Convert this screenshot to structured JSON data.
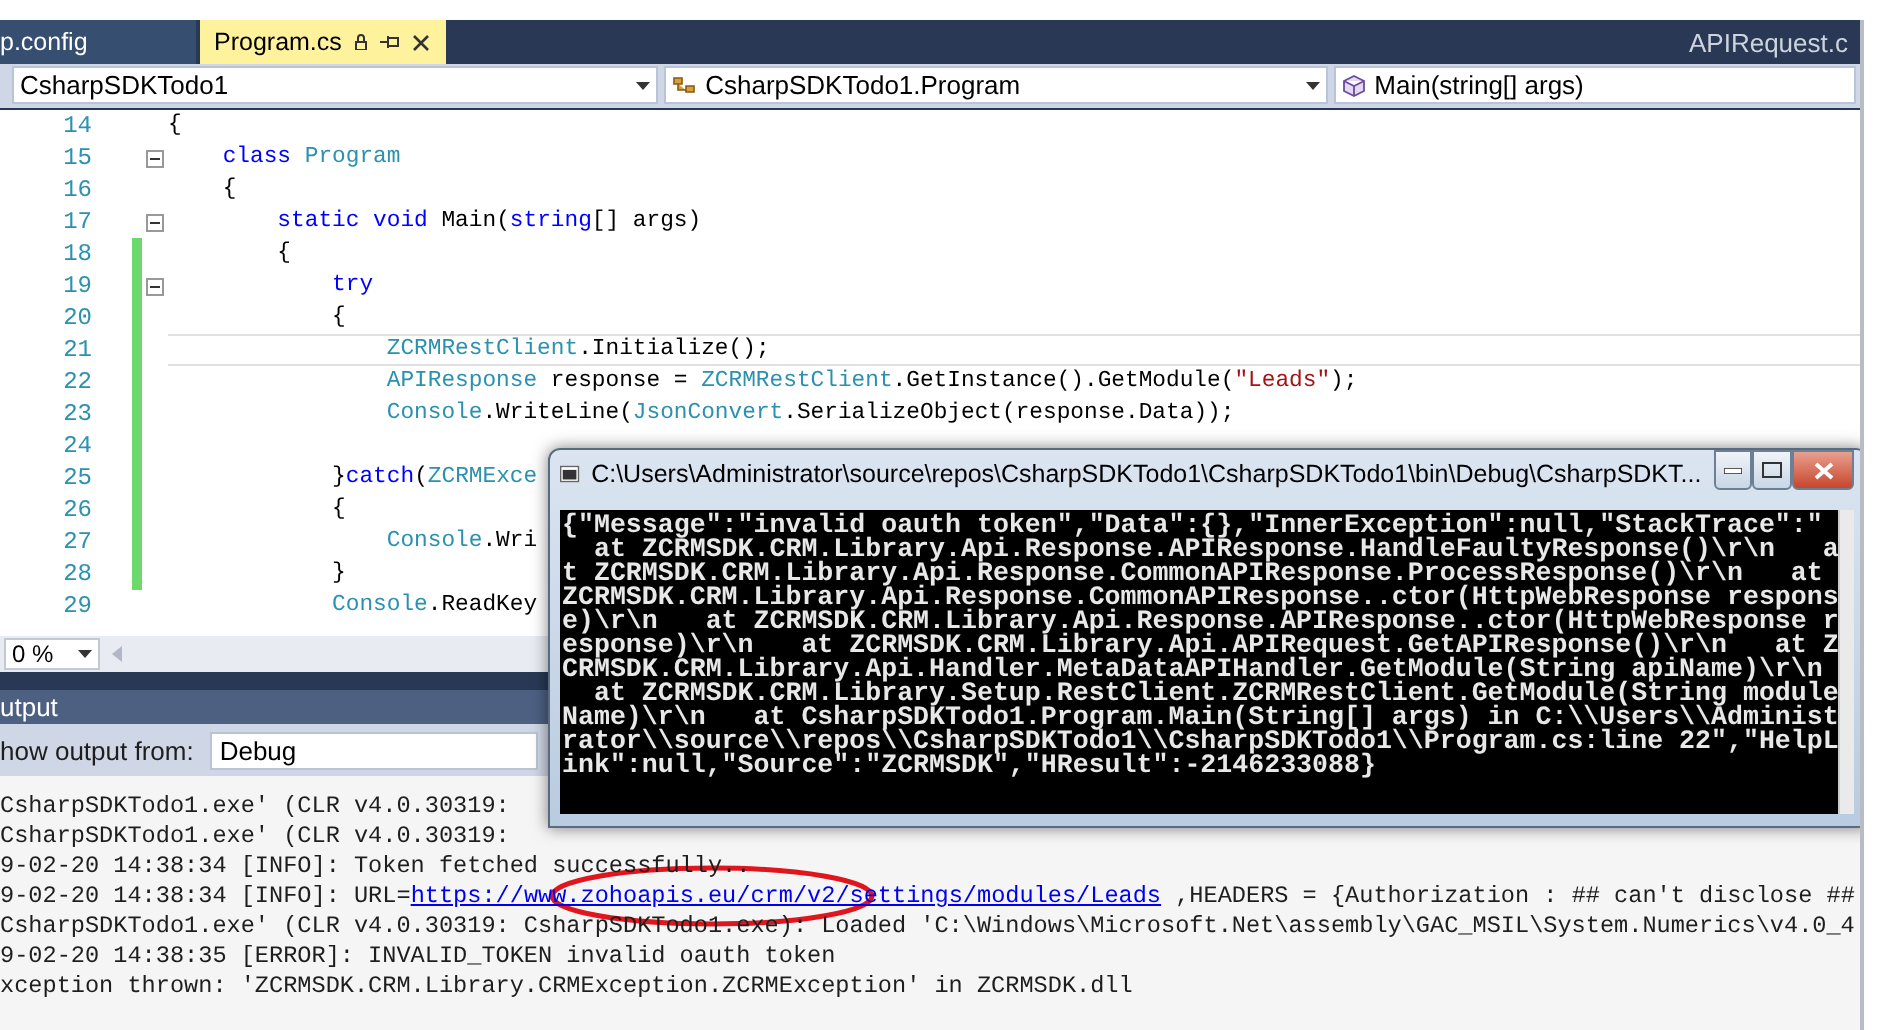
{
  "tabs": [
    {
      "label": "p.config",
      "selected": false
    },
    {
      "label": "Program.cs",
      "selected": true
    }
  ],
  "overflow_tab": "APIRequest.c",
  "navigation": {
    "project": "CsharpSDKTodo1",
    "type": "CsharpSDKTodo1.Program",
    "member": "Main(string[] args)"
  },
  "editor": {
    "zoom": "0 %",
    "lines": [
      {
        "number": "14",
        "changed": false,
        "fold": false,
        "current": false,
        "tokens": [
          {
            "kind": "plain",
            "text": "{"
          }
        ]
      },
      {
        "number": "15",
        "changed": false,
        "fold": true,
        "current": false,
        "tokens": [
          {
            "kind": "keyword",
            "text": "    class"
          },
          {
            "kind": "type",
            "text": " Program"
          }
        ]
      },
      {
        "number": "16",
        "changed": false,
        "fold": false,
        "current": false,
        "tokens": [
          {
            "kind": "plain",
            "text": "    {"
          }
        ]
      },
      {
        "number": "17",
        "changed": false,
        "fold": true,
        "current": false,
        "tokens": [
          {
            "kind": "keyword",
            "text": "        static"
          },
          {
            "kind": "keyword",
            "text": " void"
          },
          {
            "kind": "plain",
            "text": " Main("
          },
          {
            "kind": "keyword",
            "text": "string"
          },
          {
            "kind": "plain",
            "text": "[] args)"
          }
        ]
      },
      {
        "number": "18",
        "changed": true,
        "fold": false,
        "current": false,
        "tokens": [
          {
            "kind": "plain",
            "text": "        {"
          }
        ]
      },
      {
        "number": "19",
        "changed": true,
        "fold": true,
        "current": false,
        "tokens": [
          {
            "kind": "keyword",
            "text": "            try"
          }
        ]
      },
      {
        "number": "20",
        "changed": true,
        "fold": false,
        "current": false,
        "tokens": [
          {
            "kind": "plain",
            "text": "            {"
          }
        ]
      },
      {
        "number": "21",
        "changed": true,
        "fold": false,
        "current": true,
        "tokens": [
          {
            "kind": "type",
            "text": "                ZCRMRestClient"
          },
          {
            "kind": "plain",
            "text": ".Initialize();"
          }
        ]
      },
      {
        "number": "22",
        "changed": true,
        "fold": false,
        "current": false,
        "tokens": [
          {
            "kind": "type",
            "text": "                APIResponse"
          },
          {
            "kind": "plain",
            "text": " response = "
          },
          {
            "kind": "type",
            "text": "ZCRMRestClient"
          },
          {
            "kind": "plain",
            "text": ".GetInstance().GetModule("
          },
          {
            "kind": "string",
            "text": "\"Leads\""
          },
          {
            "kind": "plain",
            "text": ");"
          }
        ]
      },
      {
        "number": "23",
        "changed": true,
        "fold": false,
        "current": false,
        "tokens": [
          {
            "kind": "type",
            "text": "                Console"
          },
          {
            "kind": "plain",
            "text": ".WriteLine("
          },
          {
            "kind": "type",
            "text": "JsonConvert"
          },
          {
            "kind": "plain",
            "text": ".SerializeObject(response.Data));"
          }
        ]
      },
      {
        "number": "24",
        "changed": true,
        "fold": false,
        "current": false
      },
      {
        "number": "25",
        "changed": true,
        "fold": false,
        "current": false,
        "tokens": [
          {
            "kind": "plain",
            "text": "            }"
          },
          {
            "kind": "keyword",
            "text": "catch"
          },
          {
            "kind": "plain",
            "text": "("
          },
          {
            "kind": "type",
            "text": "ZCRMExce"
          }
        ]
      },
      {
        "number": "26",
        "changed": true,
        "fold": false,
        "current": false,
        "tokens": [
          {
            "kind": "plain",
            "text": "            {"
          }
        ]
      },
      {
        "number": "27",
        "changed": true,
        "fold": false,
        "current": false,
        "tokens": [
          {
            "kind": "type",
            "text": "                Console"
          },
          {
            "kind": "plain",
            "text": ".Wri"
          }
        ]
      },
      {
        "number": "28",
        "changed": true,
        "fold": false,
        "current": false,
        "tokens": [
          {
            "kind": "plain",
            "text": "            }"
          }
        ]
      },
      {
        "number": "29",
        "changed": false,
        "fold": false,
        "current": false,
        "tokens": [
          {
            "kind": "type",
            "text": "            Console"
          },
          {
            "kind": "plain",
            "text": ".ReadKey"
          }
        ]
      }
    ]
  },
  "output": {
    "title": "utput",
    "source_label": "how output from:",
    "source": "Debug",
    "lines": [
      {
        "text": "CsharpSDKTodo1.exe' (CLR v4.0.30319:"
      },
      {
        "text": "CsharpSDKTodo1.exe' (CLR v4.0.30319:"
      },
      {
        "text": "9-02-20 14:38:34 [INFO]: Token fetched successfully.."
      },
      {
        "text": "9-02-20 14:38:34 [INFO]: URL=",
        "link": "https://www.zohoapis.eu/crm/v2/settings/modules/Leads",
        "rest": " ,HEADERS = {Authorization : ## can't disclose ##"
      },
      {
        "text": "CsharpSDKTodo1.exe' (CLR v4.0.30319: CsharpSDKTodo1.exe): Loaded 'C:\\Windows\\Microsoft.Net\\assembly\\GAC_MSIL\\System.Numerics\\v4.0_4"
      },
      {
        "text": "9-02-20 14:38:35 [ERROR]: INVALID_TOKEN invalid oauth token"
      },
      {
        "text": "xception thrown: 'ZCRMSDK.CRM.Library.CRMException.ZCRMException' in ZCRMSDK.dll"
      }
    ]
  },
  "console": {
    "title": "C:\\Users\\Administrator\\source\\repos\\CsharpSDKTodo1\\CsharpSDKTodo1\\bin\\Debug\\CsharpSDKT...",
    "lines": [
      "{\"Message\":\"invalid oauth token\",\"Data\":{},\"InnerException\":null,\"StackTrace\":\"",
      "  at ZCRMSDK.CRM.Library.Api.Response.APIResponse.HandleFaultyResponse()\\r\\n   a",
      "t ZCRMSDK.CRM.Library.Api.Response.CommonAPIResponse.ProcessResponse()\\r\\n   at ",
      "ZCRMSDK.CRM.Library.Api.Response.CommonAPIResponse..ctor(HttpWebResponse respons",
      "e)\\r\\n   at ZCRMSDK.CRM.Library.Api.Response.APIResponse..ctor(HttpWebResponse r",
      "esponse)\\r\\n   at ZCRMSDK.CRM.Library.Api.APIRequest.GetAPIResponse()\\r\\n   at Z",
      "CRMSDK.CRM.Library.Api.Handler.MetaDataAPIHandler.GetModule(String apiName)\\r\\n",
      "  at ZCRMSDK.CRM.Library.Setup.RestClient.ZCRMRestClient.GetModule(String module",
      "Name)\\r\\n   at CsharpSDKTodo1.Program.Main(String[] args) in C:\\\\Users\\\\Administ",
      "rator\\\\source\\\\repos\\\\CsharpSDKTodo1\\\\CsharpSDKTodo1\\\\Program.cs:line 22\",\"HelpL",
      "ink\":null,\"Source\":\"ZCRMSDK\",\"HResult\":-2146233088}"
    ]
  }
}
